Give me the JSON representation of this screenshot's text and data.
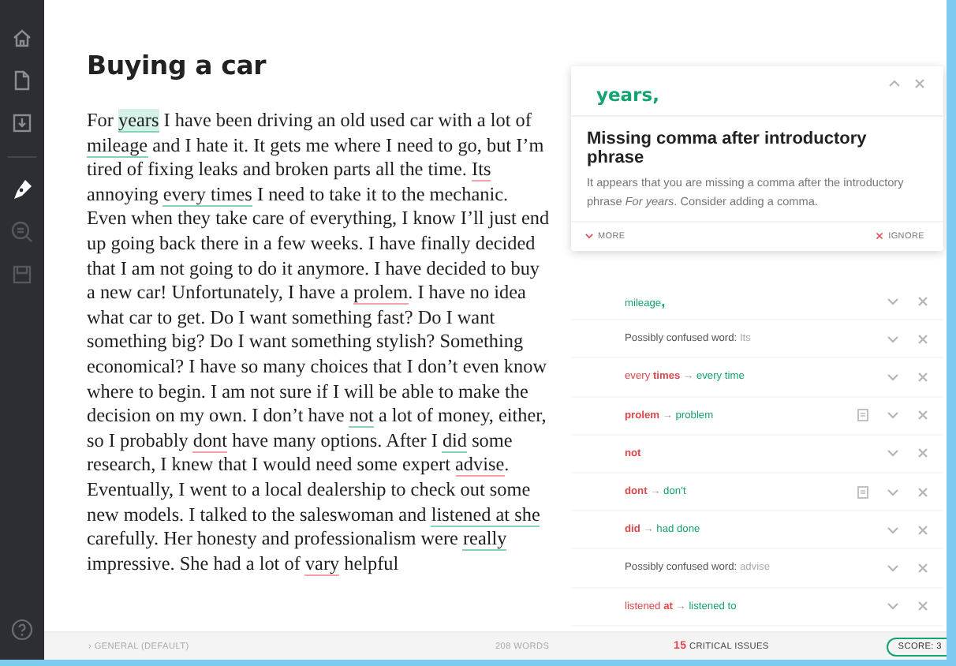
{
  "document": {
    "title": "Buying a car",
    "segments": [
      {
        "text": "For "
      },
      {
        "text": "years",
        "kind": "suggestion",
        "selected": true
      },
      {
        "text": " I have been driving an old used car with a lot of "
      },
      {
        "text": "mileage",
        "kind": "suggestion",
        "selected": false
      },
      {
        "text": " and I hate it. It gets me where I need to go, but I’m tired of fixing leaks and broken parts all the time. "
      },
      {
        "text": "Its",
        "kind": "error",
        "selected": false
      },
      {
        "text": " annoying "
      },
      {
        "text": "every times",
        "kind": "suggestion",
        "selected": false
      },
      {
        "text": " I need to take it to the mechanic. Even when they take care of everything, I know I’ll just end up going back there in a few weeks. I have finally decided that I am not going to do it anymore. I have decided to buy a new car! Unfortunately, I have a "
      },
      {
        "text": "prolem",
        "kind": "error",
        "selected": false
      },
      {
        "text": ". I have no idea what car to get. Do I want something fast? Do I want something big? Do I want something stylish? Something economical? I have so many choices that I don’t even know where to begin. I am not sure if I will be able to make the decision on my own. I don’t have "
      },
      {
        "text": "not",
        "kind": "suggestion",
        "selected": false
      },
      {
        "text": " a lot of money, either, so I probably "
      },
      {
        "text": "dont",
        "kind": "error",
        "selected": false
      },
      {
        "text": " have many options. After I "
      },
      {
        "text": "did",
        "kind": "suggestion",
        "selected": false
      },
      {
        "text": " some research, I knew that I would need some expert "
      },
      {
        "text": "advise",
        "kind": "error",
        "selected": false
      },
      {
        "text": ". Eventually, I went to a local dealership to check out some new models. I talked to the saleswoman and "
      },
      {
        "text": "listened at ",
        "kind": "suggestion",
        "selected": false
      },
      {
        "text": "she",
        "kind": "suggestion",
        "selected": false
      },
      {
        "text": " carefully. Her honesty and professionalism were "
      },
      {
        "text": "really",
        "kind": "suggestion",
        "selected": false
      },
      {
        "text": " impressive. She had a lot of "
      },
      {
        "text": "vary",
        "kind": "error",
        "selected": false
      },
      {
        "text": " helpful"
      }
    ]
  },
  "open_card": {
    "word": "years,",
    "title": "Missing comma after introductory phrase",
    "body": "It appears that you are missing a comma after the introductory phrase *For years*. Consider adding a comma.",
    "more": "MORE",
    "ignore": "IGNORE"
  },
  "cards": [
    {
      "dictionary": false,
      "parts": [
        {
          "text": "mileage",
          "kind": "fix"
        },
        {
          "text": ",",
          "kind": "fix-bold"
        }
      ]
    },
    {
      "dictionary": false,
      "parts": [
        {
          "text": "Possibly confused word: ",
          "kind": "text"
        },
        {
          "text": "Its",
          "kind": "muted"
        }
      ]
    },
    {
      "dictionary": false,
      "parts": [
        {
          "text": "every ",
          "kind": "error"
        },
        {
          "text": "times",
          "kind": "error-bold"
        },
        {
          "text": " → ",
          "kind": "arrow"
        },
        {
          "text": "every time",
          "kind": "fix"
        }
      ]
    },
    {
      "dictionary": true,
      "parts": [
        {
          "text": "prolem",
          "kind": "error-bold"
        },
        {
          "text": " → ",
          "kind": "arrow"
        },
        {
          "text": "problem",
          "kind": "fix"
        }
      ]
    },
    {
      "dictionary": false,
      "parts": [
        {
          "text": "not",
          "kind": "error-bold"
        }
      ]
    },
    {
      "dictionary": true,
      "parts": [
        {
          "text": "dont",
          "kind": "error-bold"
        },
        {
          "text": " → ",
          "kind": "arrow"
        },
        {
          "text": "don’t",
          "kind": "fix"
        }
      ]
    },
    {
      "dictionary": false,
      "parts": [
        {
          "text": "did",
          "kind": "error-bold"
        },
        {
          "text": " → ",
          "kind": "arrow"
        },
        {
          "text": "had done",
          "kind": "fix"
        }
      ]
    },
    {
      "dictionary": false,
      "parts": [
        {
          "text": "Possibly confused word: ",
          "kind": "text"
        },
        {
          "text": "advise",
          "kind": "muted"
        }
      ]
    },
    {
      "dictionary": false,
      "parts": [
        {
          "text": "listened ",
          "kind": "error"
        },
        {
          "text": "at",
          "kind": "error-bold"
        },
        {
          "text": " → ",
          "kind": "arrow"
        },
        {
          "text": "listened to",
          "kind": "fix"
        }
      ]
    }
  ],
  "status_bar": {
    "style": "› GENERAL (DEFAULT)",
    "words": "208 WORDS",
    "issues_count": "15",
    "issues_label": "CRITICAL ISSUES",
    "score": "SCORE: 3"
  }
}
